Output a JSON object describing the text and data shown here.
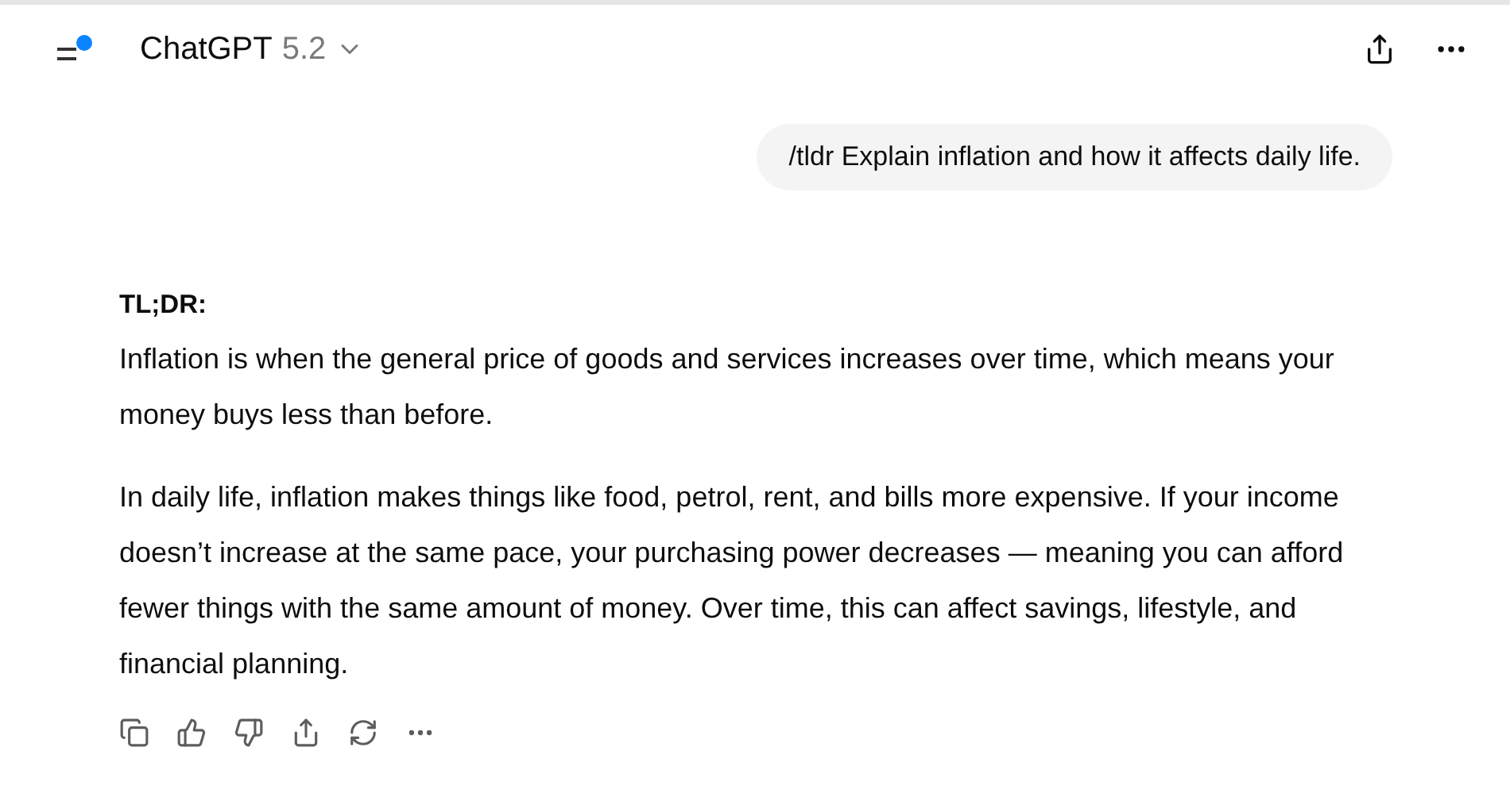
{
  "header": {
    "title": "ChatGPT",
    "version": "5.2"
  },
  "user_message": "/tldr Explain inflation and how it affects daily life.",
  "response": {
    "heading": "TL;DR:",
    "paragraphs": [
      "Inflation is when the general price of goods and services increases over time, which means your money buys less than before.",
      "In daily life, inflation makes things like food, petrol, rent, and bills more expensive. If your income doesn’t increase at the same pace, your purchasing power decreases — meaning you can afford fewer things with the same amount of money. Over time, this can affect savings, lifestyle, and financial planning."
    ]
  }
}
